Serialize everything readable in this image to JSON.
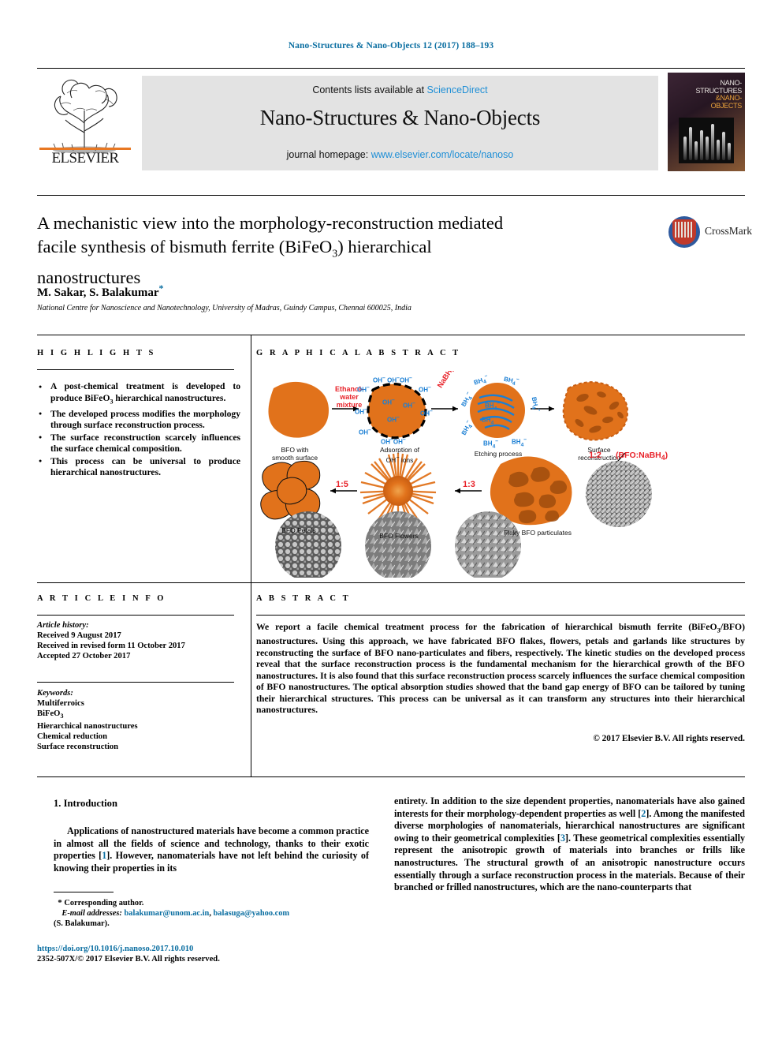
{
  "running_head": "Nano-Structures & Nano-Objects 12 (2017) 188–193",
  "masthead": {
    "contents_prefix": "Contents lists available at ",
    "contents_link": "ScienceDirect",
    "journal_title": "Nano-Structures & Nano-Objects",
    "homepage_prefix": "journal homepage: ",
    "homepage_link": "www.elsevier.com/locate/nanoso",
    "publisher": "ELSEVIER",
    "cover_line1": "NANO-",
    "cover_line2": "STRUCTURES",
    "cover_line3": "&NANO-",
    "cover_line4": "OBJECTS"
  },
  "article": {
    "title_line1": "A mechanistic view into the morphology-reconstruction mediated",
    "title_line2a": "facile synthesis of bismuth ferrite (BiFeO",
    "title_sub": "3",
    "title_line2b": ") hierarchical",
    "title_line3": "nanostructures",
    "authors": "M. Sakar, S. Balakumar",
    "affiliation": "National Centre for Nanoscience and Nanotechnology, University of Madras, Guindy Campus, Chennai 600025, India",
    "crossmark_label": "CrossMark"
  },
  "sections": {
    "highlights": "H I G H L I G H T S",
    "graphical_abstract": "G R A P H I C A L   A B S T R A C T",
    "article_info": "A R T I C L E   I N F O",
    "abstract": "A B S T R A C T"
  },
  "highlights": [
    {
      "a": "A post-chemical treatment is developed to produce BiFeO",
      "sub": "3",
      "b": " hierarchical nanostructures."
    },
    {
      "a": "The developed process modifies the morphology through surface reconstruction process.",
      "sub": "",
      "b": ""
    },
    {
      "a": "The surface reconstruction scarcely influences the surface chemical composition.",
      "sub": "",
      "b": ""
    },
    {
      "a": "This process can be universal to produce hierarchical nanostructures.",
      "sub": "",
      "b": ""
    }
  ],
  "graphical_abstract": {
    "labels": [
      {
        "id": "bfo-smooth",
        "text": "BFO with\nsmooth surface"
      },
      {
        "id": "adsorption",
        "text": "Adsorption of\nOH⁻ ions"
      },
      {
        "id": "etching",
        "text": "Etching process"
      },
      {
        "id": "surface-reconstruction",
        "text": "Surface\nreconstruction"
      },
      {
        "id": "flaky",
        "text": "Flaky BFO particulates"
      },
      {
        "id": "flowers",
        "text": "BFO Flowers"
      },
      {
        "id": "petals",
        "text": "BFO Petals"
      }
    ],
    "red_labels": [
      {
        "id": "ethanol-water",
        "text": "Ethanol-\nwater\nmixture"
      },
      {
        "id": "nabh4",
        "text": "NaBH₄"
      },
      {
        "id": "ratio-1-2",
        "text": "1:2"
      },
      {
        "id": "ratio-1-3",
        "text": "1:3"
      },
      {
        "id": "ratio-1-5",
        "text": "1:5"
      },
      {
        "id": "bfo-nabh4",
        "text": "(BFO:NaBH₄)"
      }
    ],
    "blue_labels": [
      {
        "id": "oh-ion",
        "text": "OH⁻"
      },
      {
        "id": "bh4-ion",
        "text": "BH₄⁻"
      }
    ],
    "accent_orange": "#E1721B",
    "accent_red": "#E8232A",
    "accent_blue": "#1B7FD4"
  },
  "article_info": {
    "history_label": "Article history:",
    "received": "Received 9 August 2017",
    "revised": "Received in revised form 11 October 2017",
    "accepted": "Accepted 27 October 2017",
    "keywords_label": "Keywords:",
    "keywords": [
      "Multiferroics",
      "BiFeO",
      "Hierarchical nanostructures",
      "Chemical reduction",
      "Surface reconstruction"
    ],
    "keyword_sub": "3"
  },
  "abstract_text": {
    "p1a": "We report a facile chemical treatment process for the fabrication of hierarchical bismuth ferrite (BiFeO",
    "sub": "3",
    "p1b": "/BFO) nanostructures. Using this approach, we have fabricated BFO flakes, flowers, petals and garlands like structures by reconstructing the surface of BFO nano-particulates and fibers, respectively. The kinetic studies on the developed process reveal that the surface reconstruction process is the fundamental mechanism for the hierarchical growth of the BFO nanostructures. It is also found that this surface reconstruction process scarcely influences the surface chemical composition of BFO nanostructures. The optical absorption studies showed that the band gap energy of BFO can be tailored by tuning their hierarchical structures. This process can be universal as it can transform any structures into their hierarchical nanostructures.",
    "copyright": "© 2017 Elsevier B.V. All rights reserved."
  },
  "body": {
    "intro_heading": "1. Introduction",
    "col_left_p1a": "Applications of nanostructured materials have become a common practice in almost all the fields of science and technology, thanks to their exotic properties [",
    "ref1": "1",
    "col_left_p1b": "]. However, nanomaterials have not left behind the curiosity of knowing their properties in its",
    "col_right_a": "entirety. In addition to the size dependent properties, nanomaterials have also gained interests for their morphology-dependent properties as well [",
    "ref2": "2",
    "col_right_b": "]. Among the manifested diverse morphologies of nanomaterials, hierarchical nanostructures are significant owing to their geometrical complexities [",
    "ref3": "3",
    "col_right_c": "]. These geometrical complexities essentially represent the anisotropic growth of materials into branches or frills like nanostructures. The structural growth of an anisotropic nanostructure occurs essentially through a surface reconstruction process in the materials. Because of their branched or frilled nanostructures, which are the nano-counterparts that"
  },
  "footer": {
    "corresponding": "Corresponding author.",
    "email_label": "E-mail addresses:",
    "email1": "balakumar@unom.ac.in",
    "email_sep": ", ",
    "email2": "balasuga@yahoo.com",
    "email_owner": "(S. Balakumar).",
    "doi": "https://doi.org/10.1016/j.nanoso.2017.10.010",
    "issn_line": "2352-507X/© 2017 Elsevier B.V. All rights reserved."
  }
}
